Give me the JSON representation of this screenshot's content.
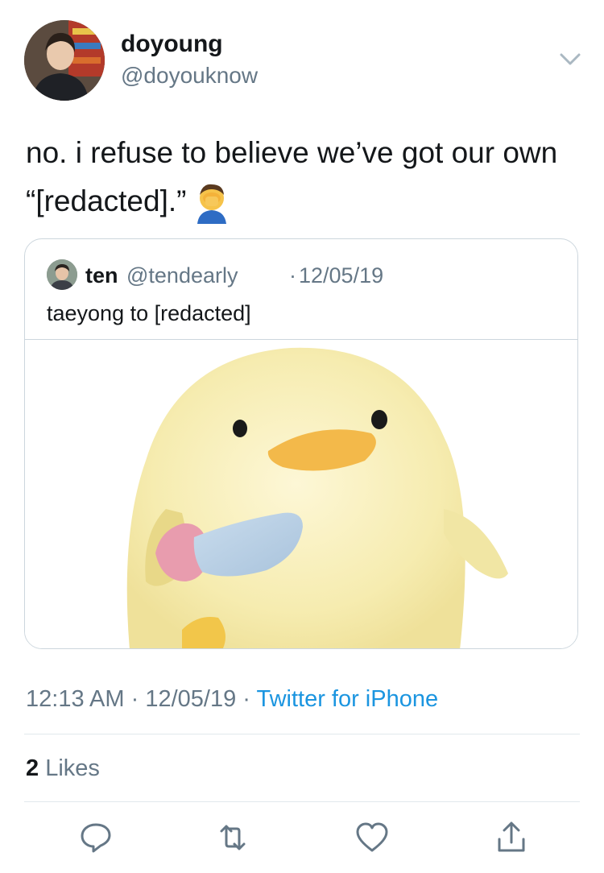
{
  "author": {
    "name": "doyoung",
    "handle": "@doyouknow"
  },
  "tweet": {
    "text": "no. i refuse to believe we’ve got our own “[redacted].”",
    "emoji": "face-palm-emoji"
  },
  "quoted": {
    "name": "ten",
    "handle": "@tendearly",
    "separator": "·",
    "date": "12/05/19",
    "text": "taeyong to [redacted]",
    "media": "chick-holding-knife-image"
  },
  "meta": {
    "time": "12:13 AM",
    "sep1": " · ",
    "date": "12/05/19",
    "sep2": " · ",
    "source": "Twitter for iPhone"
  },
  "engagement": {
    "likes_count": "2",
    "likes_label": " Likes"
  },
  "actions": [
    "reply-icon",
    "retweet-icon",
    "like-icon",
    "share-icon"
  ],
  "colors": {
    "link": "#1b95e0",
    "secondary": "#657786",
    "divider": "#e1e8ed"
  }
}
